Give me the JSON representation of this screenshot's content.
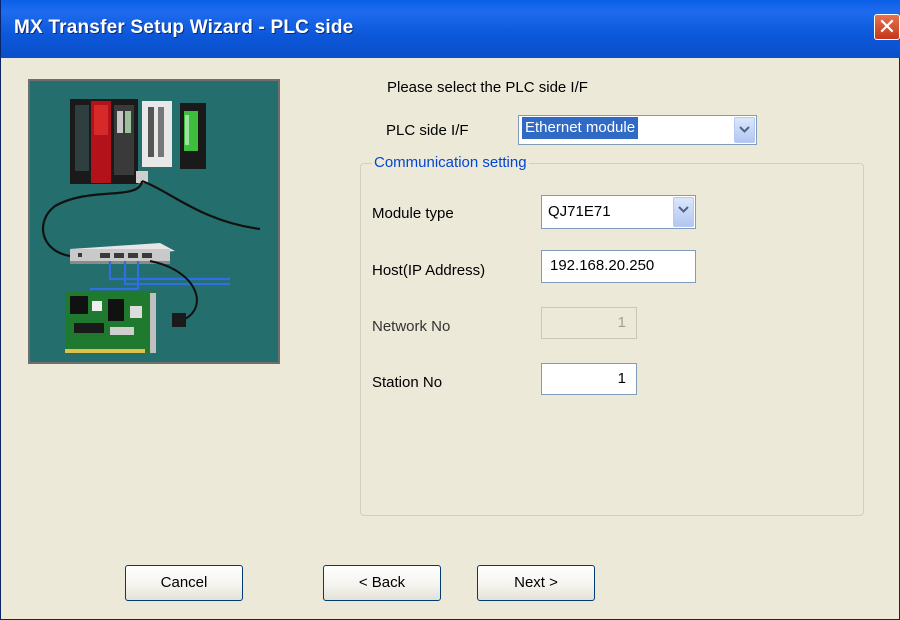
{
  "window": {
    "title": "MX Transfer Setup Wizard - PLC side",
    "close_icon": "close-icon"
  },
  "prompt": "Please select the PLC side I/F",
  "plc_if": {
    "label": "PLC side I/F",
    "selected": "Ethernet module"
  },
  "comm": {
    "legend": "Communication setting",
    "module_type": {
      "label": "Module type",
      "selected": "QJ71E71"
    },
    "host": {
      "label": "Host(IP Address)",
      "value": "192.168.20.250"
    },
    "network_no": {
      "label": "Network No",
      "value": "1"
    },
    "station_no": {
      "label": "Station No",
      "value": "1"
    }
  },
  "buttons": {
    "cancel": "Cancel",
    "back": "< Back",
    "next": "Next >"
  },
  "colors": {
    "title_bar": "#0A5FE8",
    "dialog_bg": "#ECE9D8",
    "illustration_bg": "#246E6E",
    "selection": "#316AC5",
    "group_legend": "#0046D5"
  }
}
